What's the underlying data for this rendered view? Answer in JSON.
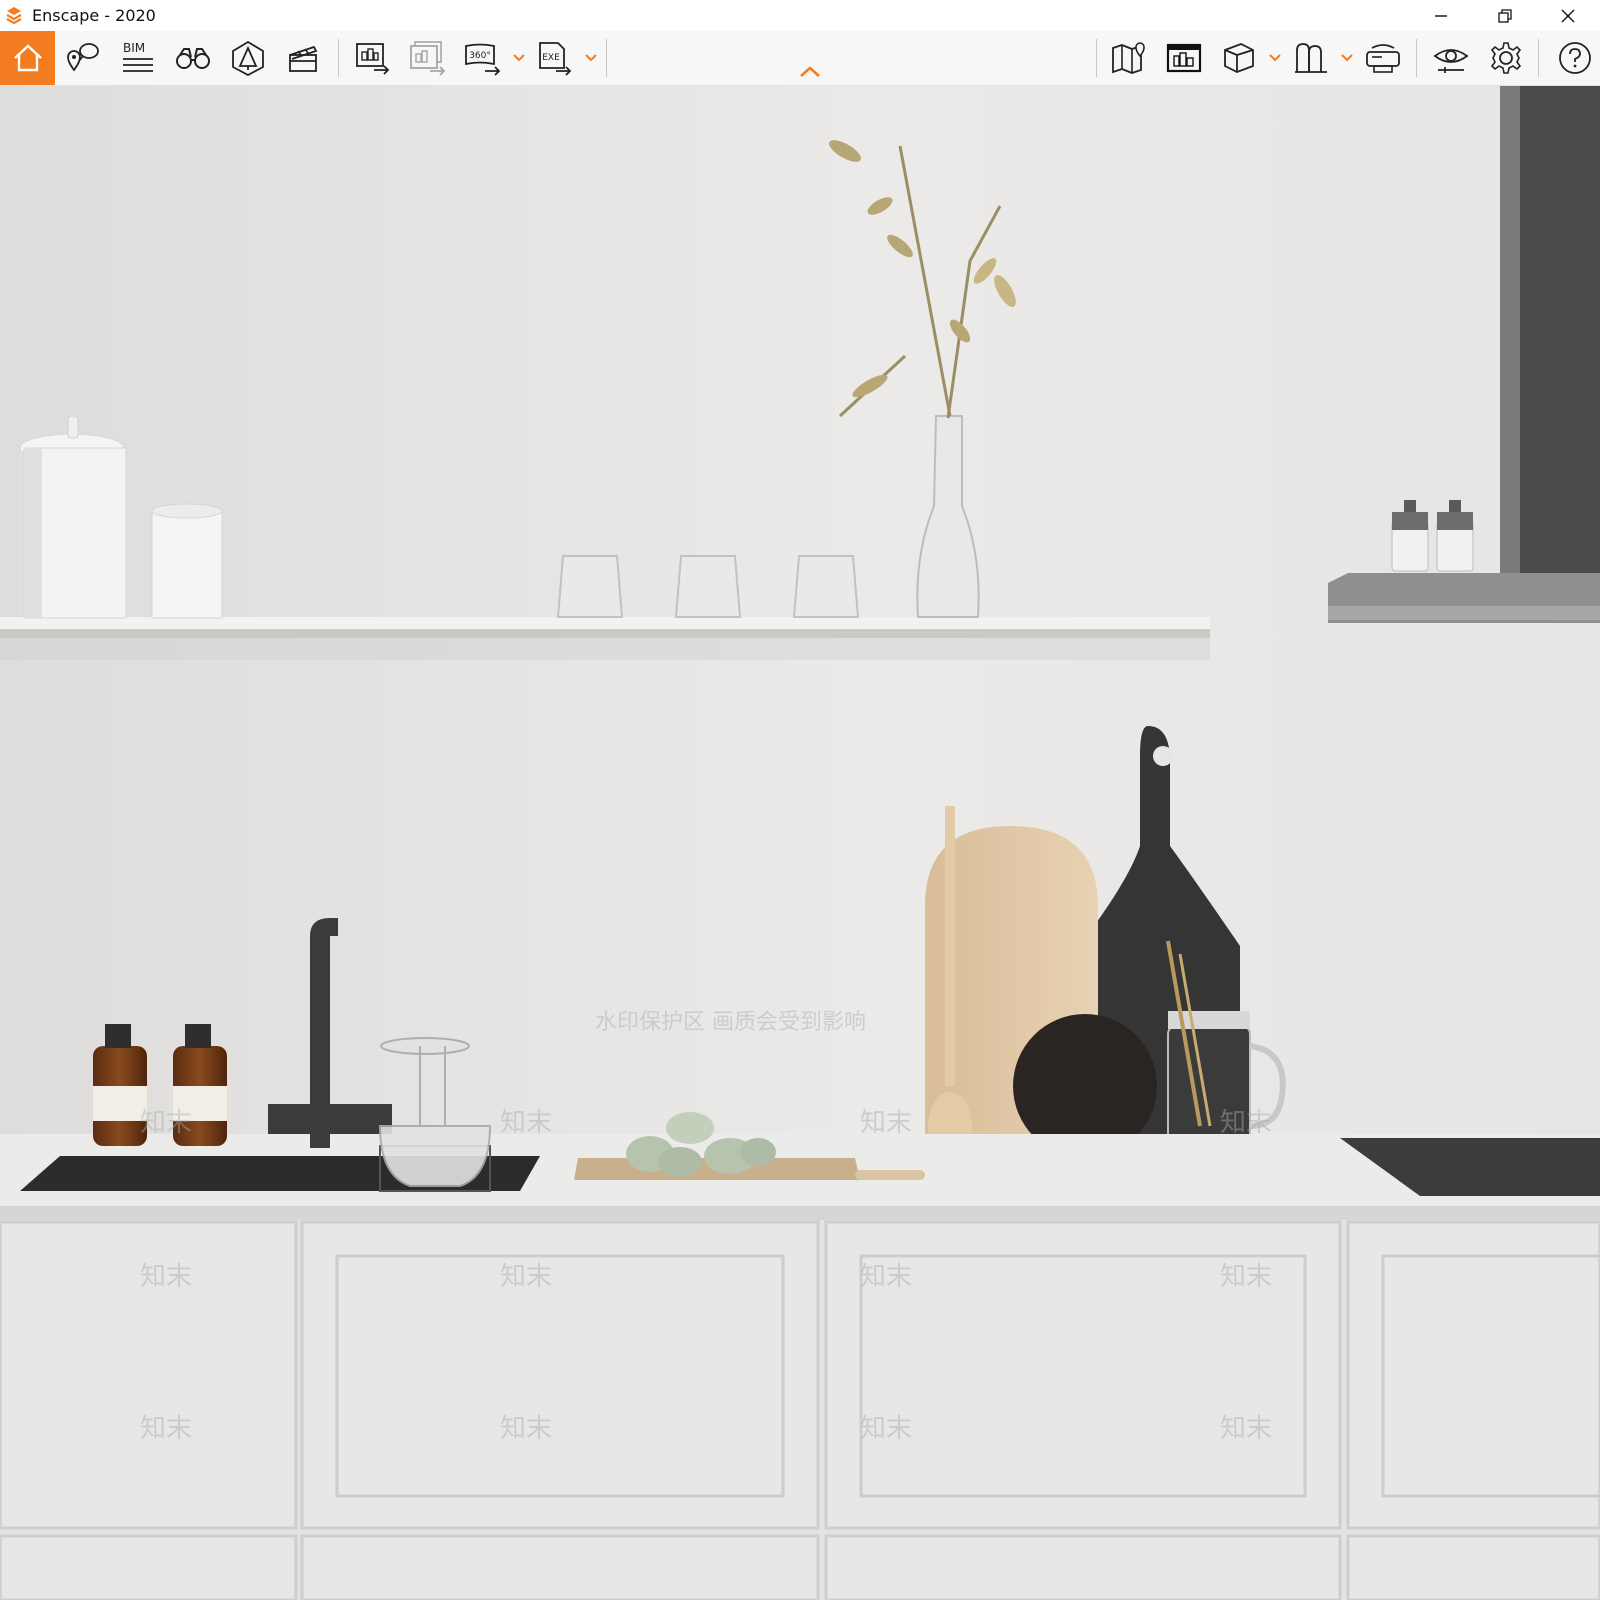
{
  "window": {
    "title": "Enscape - 2020",
    "accent_color": "#f47c20"
  },
  "toolbar": {
    "home_icon": "home-icon",
    "bim_label": "BIM",
    "panorama_label": "360°",
    "exe_label": "EXE",
    "collapse_icon": "chevron-up-icon"
  },
  "viewport": {
    "scene": "rendered kitchen interior",
    "watermark_text": "水印保护区  画质会受到影响",
    "watermark_mark": "知末"
  }
}
